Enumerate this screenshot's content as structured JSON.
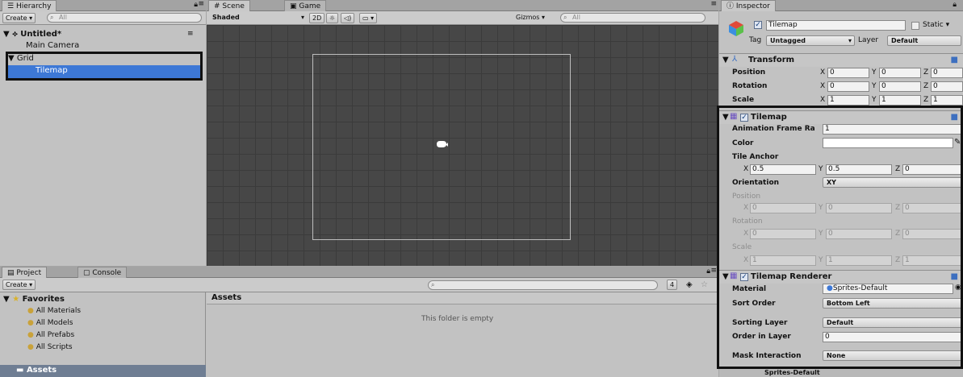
{
  "hierarchy": {
    "tab_label": "Hierarchy",
    "create_label": "Create",
    "search_placeholder": "All",
    "scene_name": "Untitled*",
    "items": [
      {
        "label": "Main Camera"
      },
      {
        "label": "Grid"
      },
      {
        "label": "Tilemap"
      }
    ]
  },
  "scene": {
    "tabs": [
      "Scene",
      "Game"
    ],
    "shading_mode": "Shaded",
    "toggle_2d_label": "2D",
    "gizmos_label": "Gizmos",
    "search_placeholder": "All"
  },
  "project": {
    "tabs": [
      "Project",
      "Console"
    ],
    "create_label": "Create",
    "favorites_label": "Favorites",
    "favorites": [
      "All Materials",
      "All Models",
      "All Prefabs",
      "All Scripts"
    ],
    "assets_root_label": "Assets",
    "assets_header": "Assets",
    "empty_message": "This folder is empty",
    "counter_label": "4"
  },
  "inspector": {
    "tab_label": "Inspector",
    "object_name": "Tilemap",
    "static_label": "Static",
    "tag_label": "Tag",
    "tag_value": "Untagged",
    "layer_label": "Layer",
    "layer_value": "Default",
    "transform": {
      "title": "Transform",
      "rows": [
        {
          "label": "Position",
          "x": "0",
          "y": "0",
          "z": "0"
        },
        {
          "label": "Rotation",
          "x": "0",
          "y": "0",
          "z": "0"
        },
        {
          "label": "Scale",
          "x": "1",
          "y": "1",
          "z": "1"
        }
      ]
    },
    "tilemap": {
      "title": "Tilemap",
      "anim_frame_rate_label": "Animation Frame Ra",
      "anim_frame_rate_value": "1",
      "color_label": "Color",
      "tile_anchor_label": "Tile Anchor",
      "tile_anchor": {
        "x": "0.5",
        "y": "0.5",
        "z": "0"
      },
      "orientation_label": "Orientation",
      "orientation_value": "XY",
      "position_label": "Position",
      "position": {
        "x": "0",
        "y": "0",
        "z": "0"
      },
      "rotation_label": "Rotation",
      "rotation": {
        "x": "0",
        "y": "0",
        "z": "0"
      },
      "scale_label": "Scale",
      "scale": {
        "x": "1",
        "y": "1",
        "z": "1"
      }
    },
    "renderer": {
      "title": "Tilemap Renderer",
      "material_label": "Material",
      "material_value": "Sprites-Default",
      "sort_order_label": "Sort Order",
      "sort_order_value": "Bottom Left",
      "sorting_layer_label": "Sorting Layer",
      "sorting_layer_value": "Default",
      "order_in_layer_label": "Order in Layer",
      "order_in_layer_value": "0",
      "mask_interaction_label": "Mask Interaction",
      "mask_interaction_value": "None"
    },
    "bottom_peek_label": "Sprites-Default"
  },
  "axes": {
    "x": "X",
    "y": "Y",
    "z": "Z"
  },
  "colors": {
    "selection": "#3d78d6",
    "scene_bg": "#474747",
    "grid_line": "#3a3a3a",
    "highlight_box": "#111111"
  }
}
